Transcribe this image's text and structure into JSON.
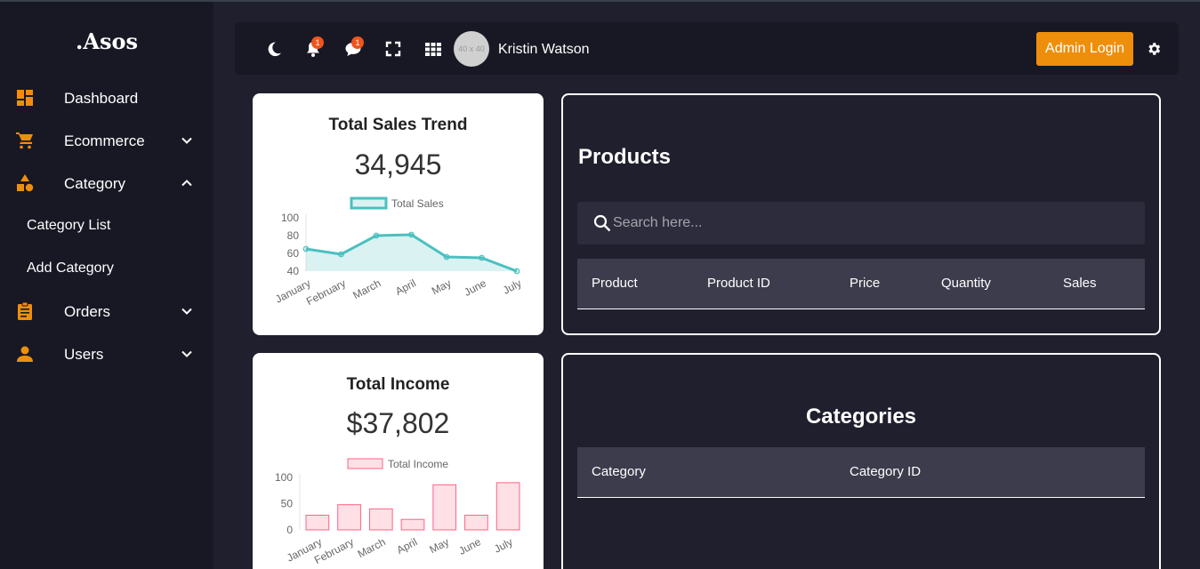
{
  "brand": ".Asos",
  "sidebar": {
    "items": [
      {
        "label": "Dashboard",
        "icon": "dashboard-icon"
      },
      {
        "label": "Ecommerce",
        "icon": "cart-icon",
        "expanded": false
      },
      {
        "label": "Category",
        "icon": "shapes-icon",
        "expanded": true
      },
      {
        "label": "Orders",
        "icon": "clipboard-icon",
        "expanded": false
      },
      {
        "label": "Users",
        "icon": "user-icon",
        "expanded": false
      }
    ],
    "subitems": [
      {
        "label": "Category List"
      },
      {
        "label": "Add Category"
      }
    ]
  },
  "header": {
    "icons": [
      "moon-icon",
      "bell-icon",
      "chat-icon",
      "fullscreen-icon",
      "apps-grid-icon"
    ],
    "notification_count": "1",
    "message_count": "1",
    "avatar_placeholder": "40 x 40",
    "username": "Kristin Watson",
    "admin_button": "Admin Login"
  },
  "colors": {
    "accent": "#ee8f0b",
    "badge": "#f2541b",
    "sales_line": "#4bc0c0",
    "income_bar": "#ff6384"
  },
  "sales_card": {
    "title": "Total Sales Trend",
    "value": "34,945"
  },
  "income_card": {
    "title": "Total Income",
    "value": "$37,802"
  },
  "chart_data": [
    {
      "type": "line",
      "categories": [
        "January",
        "February",
        "March",
        "April",
        "May",
        "June",
        "July"
      ],
      "series": [
        {
          "name": "Total Sales",
          "values": [
            65,
            59,
            80,
            81,
            56,
            55,
            40
          ]
        }
      ],
      "yticks": [
        "100",
        "80",
        "60",
        "40"
      ],
      "ylim": [
        40,
        100
      ],
      "legend": "top",
      "grid": false
    },
    {
      "type": "bar",
      "categories": [
        "January",
        "February",
        "March",
        "April",
        "May",
        "June",
        "July"
      ],
      "series": [
        {
          "name": "Total Income",
          "values": [
            28,
            48,
            40,
            20,
            86,
            28,
            90
          ]
        }
      ],
      "yticks": [
        "100",
        "50",
        "0"
      ],
      "ylim": [
        0,
        100
      ],
      "legend": "top",
      "grid": false
    }
  ],
  "products": {
    "title": "Products",
    "search_placeholder": "Search here...",
    "columns": [
      "Product",
      "Product ID",
      "Price",
      "Quantity",
      "Sales"
    ]
  },
  "categories": {
    "title": "Categories",
    "columns": [
      "Category",
      "Category ID"
    ]
  }
}
